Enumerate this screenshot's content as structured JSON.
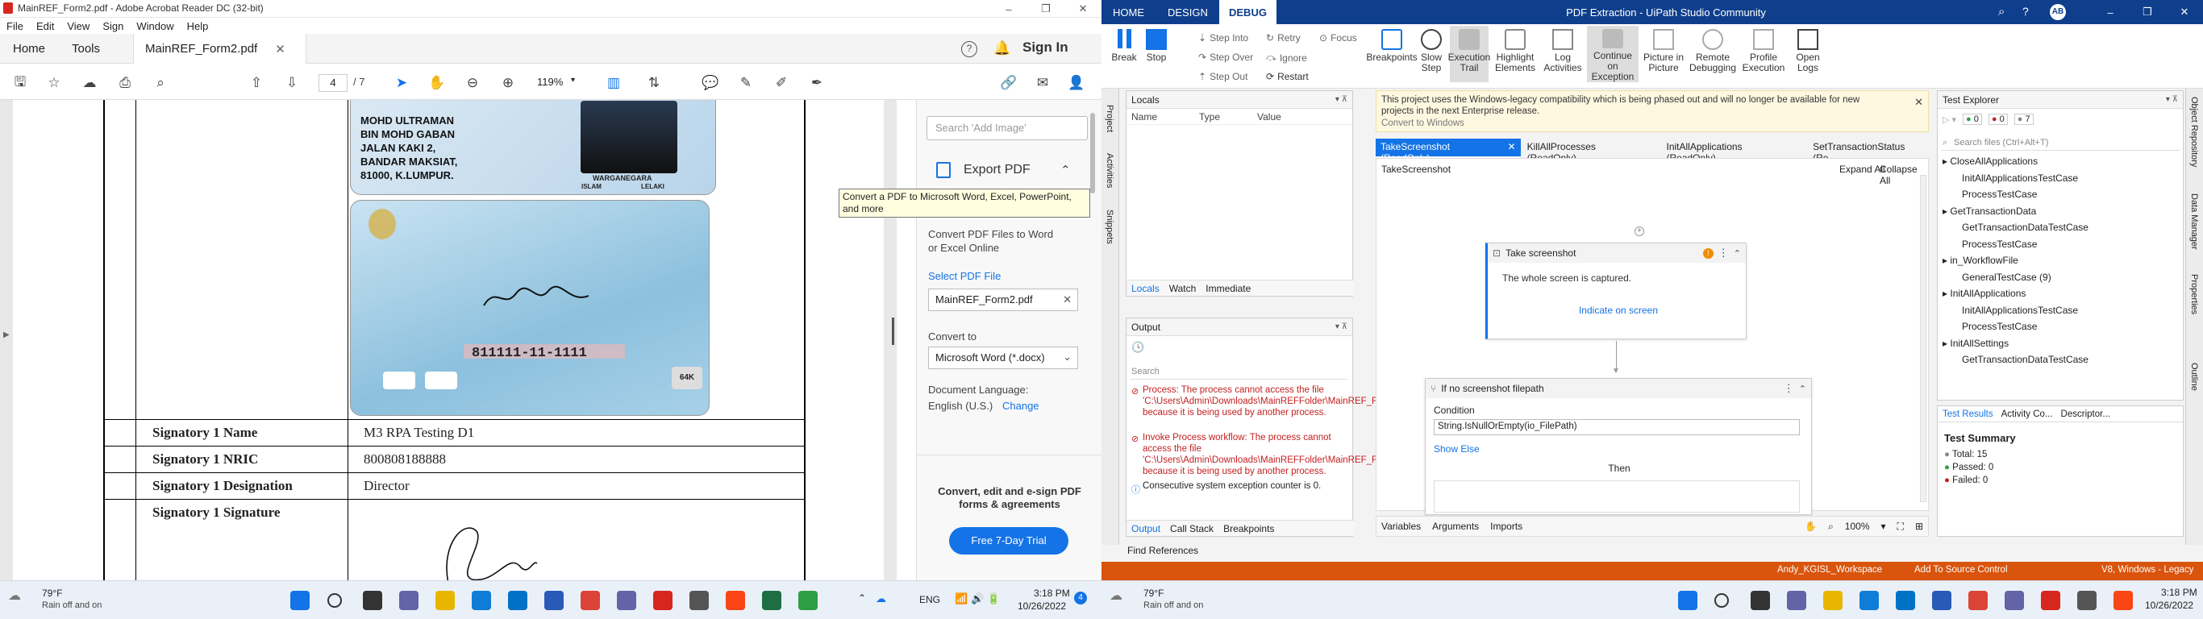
{
  "acrobat": {
    "window_title": "MainREF_Form2.pdf - Adobe Acrobat Reader DC (32-bit)",
    "menu": [
      "File",
      "Edit",
      "View",
      "Sign",
      "Window",
      "Help"
    ],
    "tabs": {
      "home": "Home",
      "tools": "Tools",
      "doc": "MainREF_Form2.pdf"
    },
    "sign_in": "Sign In",
    "page_current": "4",
    "page_total": "/ 7",
    "zoom": "119%",
    "search_placeholder": "Search 'Add Image'",
    "export_title": "Export PDF",
    "tooltip": "Convert a PDF to Microsoft Word, Excel, PowerPoint, and more",
    "export_desc": "Convert PDF Files to Word or Excel Online",
    "select_file_label": "Select PDF File",
    "selected_file": "MainREF_Form2.pdf",
    "convert_to_label": "Convert to",
    "convert_to_value": "Microsoft Word (*.docx)",
    "doc_language_label": "Document Language:",
    "doc_language_value": "English (U.S.)",
    "change_link": "Change",
    "promo_text": "Convert, edit and e-sign PDF forms & agreements",
    "trial_button": "Free 7-Day Trial",
    "id_card": {
      "name_lines": [
        "MOHD ULTRAMAN",
        "BIN MOHD GABAN",
        "JALAN KAKI 2,",
        "BANDAR MAKSIAT,",
        "81000, K.LUMPUR."
      ],
      "citizen": "WARGANEGARA",
      "religion": "ISLAM",
      "gender": "LELAKI",
      "back_number": "811111-11-1111",
      "chip": "64K"
    },
    "table_rows": [
      {
        "label": "Signatory 1 Name",
        "value": "M3 RPA Testing D1"
      },
      {
        "label": "Signatory 1 NRIC",
        "value": "800808188888"
      },
      {
        "label": "Signatory 1 Designation",
        "value": "Director"
      },
      {
        "label": "Signatory 1 Signature",
        "value": ""
      }
    ]
  },
  "uipath": {
    "tabs": {
      "home": "HOME",
      "design": "DESIGN",
      "debug": "DEBUG"
    },
    "window_title": "PDF Extraction - UiPath Studio Community",
    "avatar": "AB",
    "ribbon": {
      "break": "Break",
      "stop": "Stop",
      "step_into": "Step Into",
      "step_over": "Step Over",
      "step_out": "Step Out",
      "retry": "Retry",
      "ignore": "Ignore",
      "restart": "Restart",
      "focus": "Focus",
      "breakpoints": "Breakpoints",
      "slow_step": "Slow Step",
      "execution_trail": "Execution Trail",
      "highlight": "Highlight Elements",
      "log_activities": "Log Activities",
      "continue_exception": "Continue on Exception",
      "picture_in_picture": "Picture in Picture",
      "remote_debugging": "Remote Debugging",
      "profile_execution": "Profile Execution",
      "open_logs": "Open Logs"
    },
    "left_rail": [
      "Project",
      "Activities",
      "Snippets"
    ],
    "locals": {
      "title": "Locals",
      "cols": [
        "Name",
        "Type",
        "Value"
      ],
      "tabs": [
        "Locals",
        "Watch",
        "Immediate"
      ]
    },
    "output": {
      "title": "Output",
      "search_placeholder": "Search",
      "messages": [
        "Process: The process cannot access the file 'C:\\Users\\Admin\\Downloads\\MainREFFolder\\MainREF_Form2.xlsx' because it is being used by another process.",
        "Invoke Process workflow: The process cannot access the file 'C:\\Users\\Admin\\Downloads\\MainREFFolder\\MainREF_Form2.xlsx' because it is being used by another process.",
        "Consecutive system exception counter is 0."
      ],
      "tabs": [
        "Output",
        "Call Stack",
        "Breakpoints"
      ]
    },
    "find_references": "Find References",
    "banner": {
      "text": "This project uses the Windows-legacy compatibility which is being phased out and will no longer be available for new projects in the next Enterprise release.",
      "link": "Convert to Windows"
    },
    "doc_tabs": [
      "TakeScreenshot (ReadOnly)",
      "KillAllProcesses (ReadOnly)",
      "InitAllApplications (ReadOnly)",
      "SetTransactionStatus (Re"
    ],
    "breadcrumb": "TakeScreenshot",
    "expand_all": "Expand All",
    "collapse_all": "Collapse All",
    "activity1": {
      "title": "Take screenshot",
      "desc": "The whole screen is captured.",
      "link": "Indicate on screen"
    },
    "activity2": {
      "title": "If no screenshot filepath",
      "cond_label": "Condition",
      "cond_value": "String.IsNullOrEmpty(io_FilePath)",
      "show_else": "Show Else",
      "then": "Then"
    },
    "designer_footer": {
      "tabs": [
        "Variables",
        "Arguments",
        "Imports"
      ],
      "zoom": "100%"
    },
    "test_explorer": {
      "title": "Test Explorer",
      "counts": [
        "0",
        "0",
        "7"
      ],
      "search_placeholder": "Search files (Ctrl+Alt+T)",
      "tree": [
        {
          "t": "CloseAllApplications",
          "lvl": 0
        },
        {
          "t": "InitAllApplicationsTestCase",
          "lvl": 1
        },
        {
          "t": "ProcessTestCase",
          "lvl": 1
        },
        {
          "t": "GetTransactionData",
          "lvl": 0
        },
        {
          "t": "GetTransactionDataTestCase",
          "lvl": 1
        },
        {
          "t": "ProcessTestCase",
          "lvl": 1
        },
        {
          "t": "in_WorkflowFile",
          "lvl": 0
        },
        {
          "t": "GeneralTestCase (9)",
          "lvl": 1
        },
        {
          "t": "InitAllApplications",
          "lvl": 0
        },
        {
          "t": "InitAllApplicationsTestCase",
          "lvl": 1
        },
        {
          "t": "ProcessTestCase",
          "lvl": 1
        },
        {
          "t": "InitAllSettings",
          "lvl": 0
        },
        {
          "t": "GetTransactionDataTestCase",
          "lvl": 1
        }
      ],
      "bottom_tabs": [
        "Test Results",
        "Activity Co...",
        "Descriptor..."
      ],
      "summary_title": "Test Summary",
      "total": "Total: 15",
      "passed": "Passed: 0",
      "failed": "Failed: 0"
    },
    "right_rail": [
      "Object Repository",
      "Data Manager",
      "Properties",
      "Outline"
    ],
    "status": {
      "workspace": "Andy_KGISL_Workspace",
      "source_control": "Add To Source Control",
      "version": "V8, Windows - Legacy"
    }
  },
  "taskbar": {
    "weather_temp": "79°F",
    "weather_desc": "Rain off and on",
    "lang": "ENG",
    "time": "3:18 PM",
    "date": "10/26/2022",
    "notif": "4"
  }
}
